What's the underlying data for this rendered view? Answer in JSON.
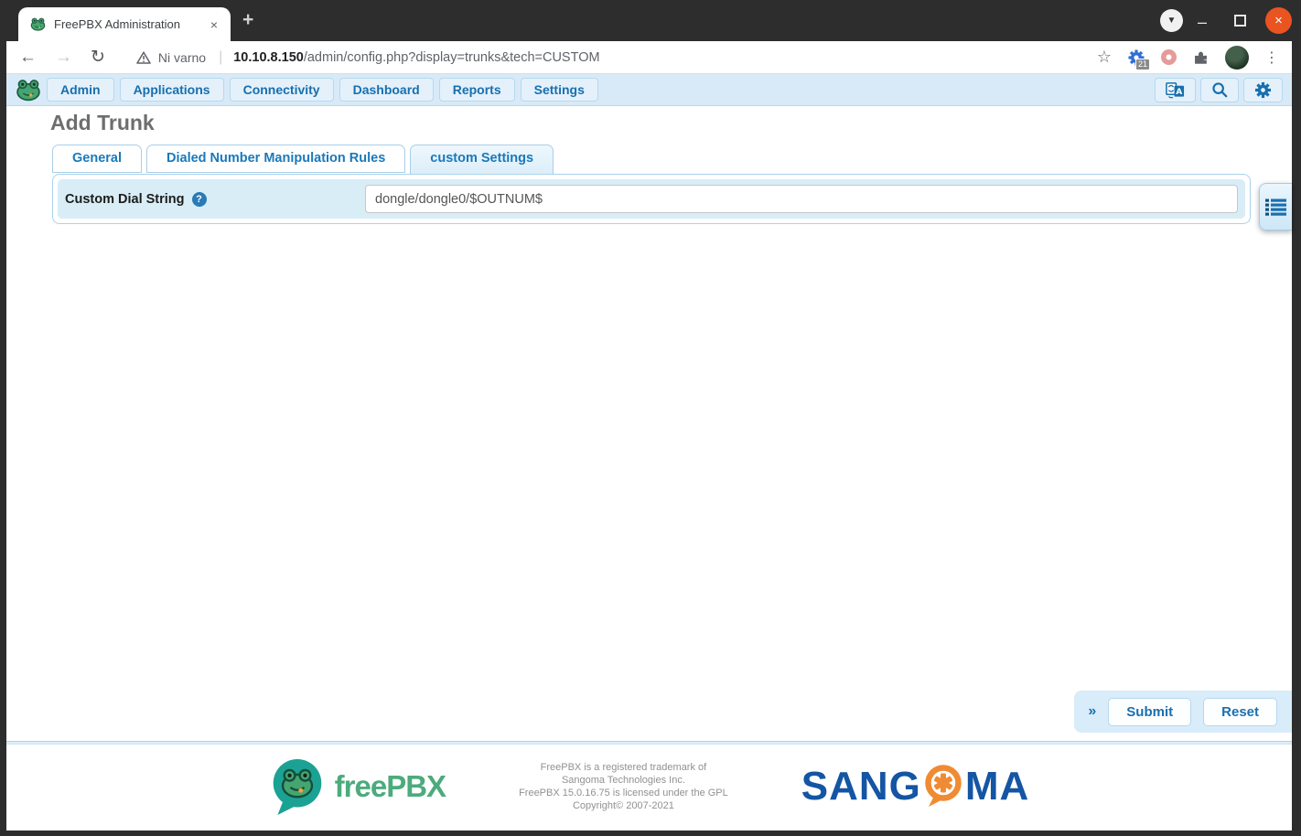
{
  "browser": {
    "tab_title": "FreePBX Administration",
    "tab_close": "×",
    "new_tab": "+",
    "window_controls": {
      "menu_chevron": "▼",
      "minimize": "–",
      "close": "×"
    },
    "address_bar": {
      "back": "←",
      "forward": "→",
      "reload": "↻",
      "security_label": "Ni varno",
      "separator": "|",
      "url_host": "10.10.8.150",
      "url_path": "/admin/config.php?display=trunks&tech=CUSTOM",
      "bookmark_star": "☆",
      "extension_badge": "21",
      "menu_dots": "⋮"
    }
  },
  "navbar": {
    "items": [
      "Admin",
      "Applications",
      "Connectivity",
      "Dashboard",
      "Reports",
      "Settings"
    ]
  },
  "page": {
    "title": "Add Trunk",
    "tabs": [
      {
        "label": "General"
      },
      {
        "label": "Dialed Number Manipulation Rules"
      },
      {
        "label": "custom Settings",
        "active": true
      }
    ],
    "form": {
      "label": "Custom Dial String",
      "help": "?",
      "value": "dongle/dongle0/$OUTNUM$"
    }
  },
  "actions": {
    "expand": "»",
    "submit": "Submit",
    "reset": "Reset"
  },
  "footer": {
    "brand": "freePBX",
    "lines": [
      "FreePBX is a registered trademark of",
      "Sangoma Technologies Inc.",
      "FreePBX 15.0.16.75 is licensed under the GPL",
      "Copyright© 2007-2021"
    ],
    "sangoma_left": "SANG",
    "sangoma_right": "MA"
  },
  "colors": {
    "accent_blue": "#1a6faf",
    "panel_blue": "#d9edf7",
    "navbar_blue": "#d8eaf8",
    "ubuntu_orange": "#e95420",
    "freepbx_green": "#4cab7d",
    "freepbx_teal": "#1ba294",
    "sangoma_blue": "#1455a4",
    "sangoma_orange": "#f08b33"
  }
}
